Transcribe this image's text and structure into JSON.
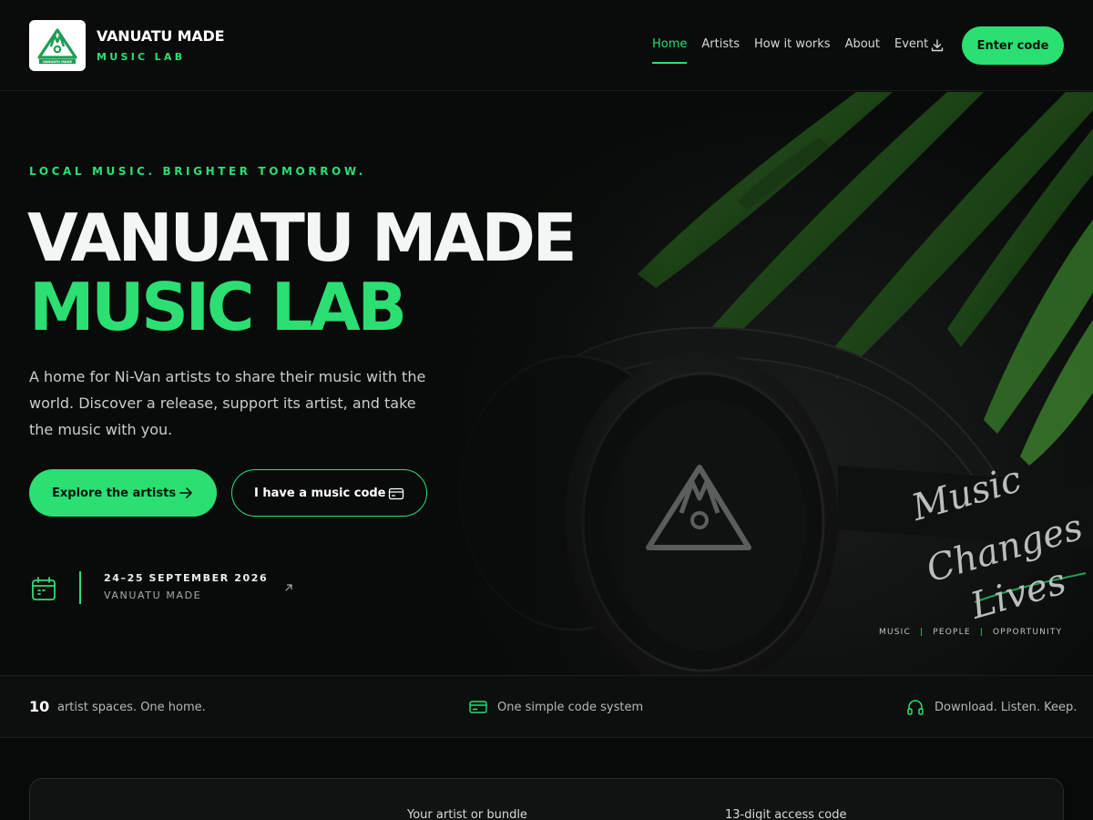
{
  "header": {
    "brand_title": "VANUATU MADE",
    "brand_subtitle": "MUSIC LAB",
    "logo_text": "VANUATU MADE",
    "nav": [
      {
        "label": "Home",
        "active": true
      },
      {
        "label": "Artists",
        "active": false
      },
      {
        "label": "How it works",
        "active": false
      },
      {
        "label": "About",
        "active": false
      },
      {
        "label": "Event",
        "active": false
      }
    ],
    "download_icon": "download-icon",
    "cta_label": "Enter code"
  },
  "hero": {
    "eyebrow": "LOCAL MUSIC. BRIGHTER TOMORROW.",
    "title_line1": "VANUATU MADE",
    "title_line2": "MUSIC LAB",
    "lede": "A home for Ni-Van artists to share their music with the world. Discover a release, support its artist, and take the music with you.",
    "primary_button": "Explore the artists",
    "secondary_button": "I have a music code",
    "event": {
      "date": "24–25 SEPTEMBER 2026",
      "place": "VANUATU MADE"
    },
    "script": [
      "Music",
      "Changes",
      "Lives"
    ],
    "tagline": [
      "MUSIC",
      "PEOPLE",
      "OPPORTUNITY"
    ]
  },
  "stats": {
    "count": "10",
    "item1": "artist spaces. One home.",
    "item2": "One simple code system",
    "item3": "Download. Listen. Keep."
  },
  "panel": {
    "label_artist": "Your artist or bundle",
    "label_code": "13-digit access code"
  },
  "colors": {
    "accent": "#2bdf73",
    "background": "#080a09",
    "text": "#f2f4f3"
  }
}
